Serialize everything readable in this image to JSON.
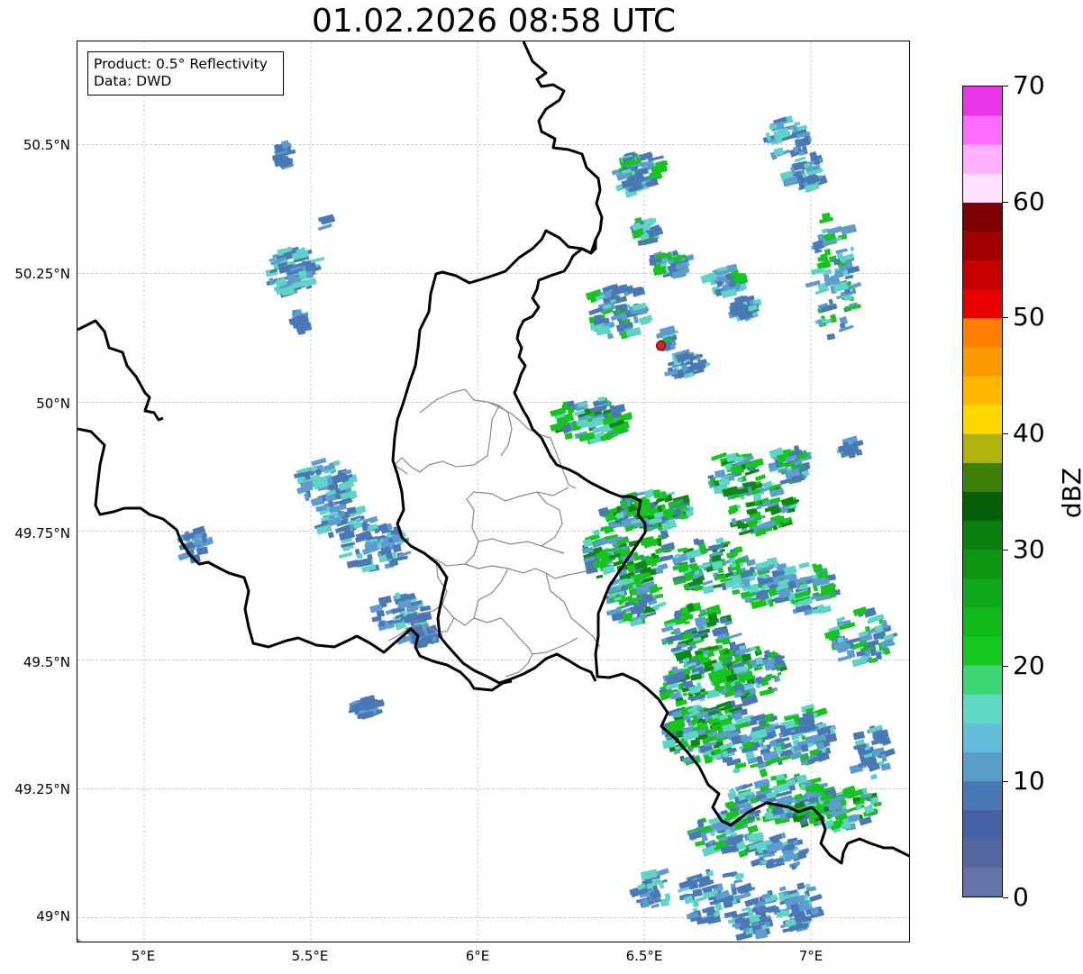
{
  "title": "01.02.2026 08:58 UTC",
  "info_box": {
    "product": "Product: 0.5° Reflectivity",
    "data_source": "Data: DWD"
  },
  "axes": {
    "lon_range": [
      4.8,
      7.3
    ],
    "lat_range": [
      48.95,
      50.7
    ],
    "x_ticks": [
      {
        "value": 5.0,
        "label": "5°E"
      },
      {
        "value": 5.5,
        "label": "5.5°E"
      },
      {
        "value": 6.0,
        "label": "6°E"
      },
      {
        "value": 6.5,
        "label": "6.5°E"
      },
      {
        "value": 7.0,
        "label": "7°E"
      }
    ],
    "y_ticks": [
      {
        "value": 50.5,
        "label": "50.5°N"
      },
      {
        "value": 50.25,
        "label": "50.25°N"
      },
      {
        "value": 50.0,
        "label": "50°N"
      },
      {
        "value": 49.75,
        "label": "49.75°N"
      },
      {
        "value": 49.5,
        "label": "49.5°N"
      },
      {
        "value": 49.25,
        "label": "49.25°N"
      },
      {
        "value": 49.0,
        "label": "49°N"
      }
    ],
    "grid": true
  },
  "radar_site": {
    "lon": 6.55,
    "lat": 50.11,
    "color": "#e02020"
  },
  "colorbar": {
    "label": "dBZ",
    "min": 0,
    "max": 70,
    "tick_labels": [
      "0",
      "10",
      "20",
      "30",
      "40",
      "50",
      "60",
      "70"
    ],
    "colors": [
      "#6575a8",
      "#5468a0",
      "#4560a6",
      "#4a78b4",
      "#579ec8",
      "#63bfdc",
      "#5fd8c4",
      "#3fd675",
      "#14c81e",
      "#10b81a",
      "#0ea818",
      "#0c9614",
      "#0a7f10",
      "#066008",
      "#3f7f0c",
      "#afb30c",
      "#ffd800",
      "#ffb700",
      "#ff9a00",
      "#ff7f00",
      "#e60000",
      "#c60000",
      "#a00000",
      "#7f0000",
      "#ffe0ff",
      "#ffb0ff",
      "#ff6cff",
      "#ea36ea"
    ]
  },
  "echo_colors": {
    "weak": "#4a78b4",
    "light": "#5e9bd0",
    "moderate": "#5fd3c4",
    "strong": "#16c41e",
    "heavy": "#0a8a12"
  }
}
